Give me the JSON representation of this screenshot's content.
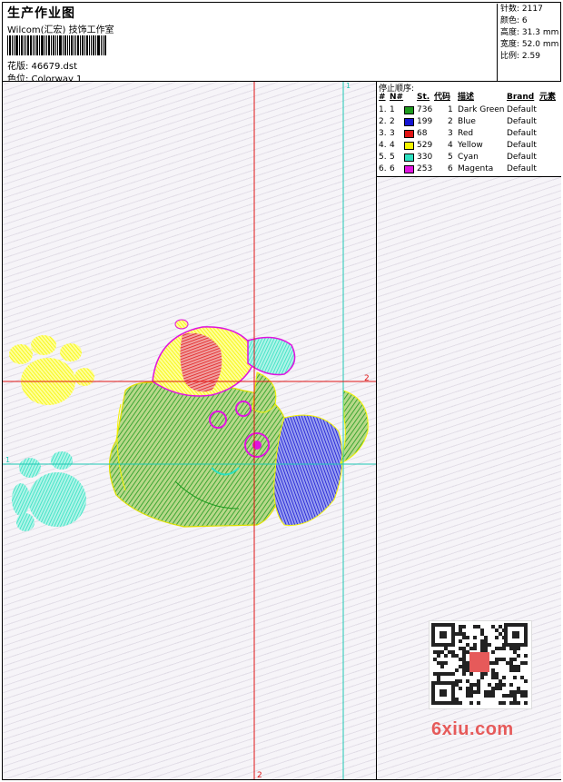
{
  "header": {
    "title": "生产作业图",
    "company": "Wilcom(汇宏) 技饰工作室",
    "design_label": "花版: 46679.dst",
    "colorway_label": "色位: Colorway 1"
  },
  "stats": [
    {
      "label": "针数:",
      "value": "2117"
    },
    {
      "label": "颜色:",
      "value": "6"
    },
    {
      "label": "高度:",
      "value": "31.3 mm"
    },
    {
      "label": "宽度:",
      "value": "52.0 mm"
    },
    {
      "label": "比例:",
      "value": "2.59"
    }
  ],
  "stop_table": {
    "title": "停止顺序:",
    "headers": {
      "seq": "#",
      "needle": "N#",
      "stitches": "St.",
      "code": "代码",
      "desc": "描述",
      "brand": "Brand",
      "element": "元素"
    },
    "rows": [
      {
        "seq": "1.",
        "needle": "1",
        "color": "#1e9a1e",
        "stitches": "736",
        "code": "1",
        "desc": "Dark Green",
        "brand": "Default"
      },
      {
        "seq": "2.",
        "needle": "2",
        "color": "#1414d2",
        "stitches": "199",
        "code": "2",
        "desc": "Blue",
        "brand": "Default"
      },
      {
        "seq": "3.",
        "needle": "3",
        "color": "#e01414",
        "stitches": "68",
        "code": "3",
        "desc": "Red",
        "brand": "Default"
      },
      {
        "seq": "4.",
        "needle": "4",
        "color": "#f5f500",
        "stitches": "529",
        "code": "4",
        "desc": "Yellow",
        "brand": "Default"
      },
      {
        "seq": "5.",
        "needle": "5",
        "color": "#2ee0c0",
        "stitches": "330",
        "code": "5",
        "desc": "Cyan",
        "brand": "Default"
      },
      {
        "seq": "6.",
        "needle": "6",
        "color": "#e014e0",
        "stitches": "253",
        "code": "6",
        "desc": "Magenta",
        "brand": "Default"
      }
    ]
  },
  "guides": {
    "vertical_top": "1",
    "horizontal_right": "2",
    "horizontal_left": "1",
    "vertical_bottom": "2",
    "line_red": "#e01414",
    "line_cyan": "#1ec8b4"
  },
  "watermark": "6xiu.com"
}
